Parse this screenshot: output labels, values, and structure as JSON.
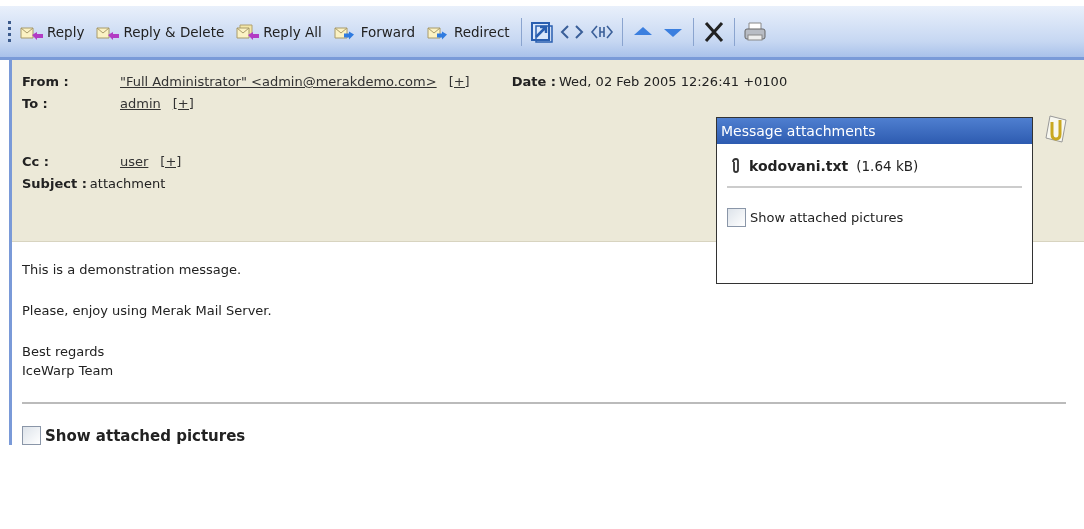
{
  "toolbar": {
    "items": [
      {
        "kind": "reply",
        "label": "Reply"
      },
      {
        "kind": "reply",
        "label": "Reply & Delete"
      },
      {
        "kind": "reply-all",
        "label": "Reply All"
      },
      {
        "kind": "forward",
        "label": "Forward"
      },
      {
        "kind": "forward",
        "label": "Redirect"
      },
      {
        "kind": "separator"
      },
      {
        "kind": "popout"
      },
      {
        "kind": "source"
      },
      {
        "kind": "source-alt"
      },
      {
        "kind": "separator"
      },
      {
        "kind": "up"
      },
      {
        "kind": "down"
      },
      {
        "kind": "separator"
      },
      {
        "kind": "delete"
      },
      {
        "kind": "separator"
      },
      {
        "kind": "print"
      }
    ]
  },
  "header": {
    "from": {
      "label": "From :",
      "value": "\"Full Administrator\" <admin@merakdemo.com>",
      "add": "[+]"
    },
    "date": {
      "label": "Date :",
      "value": "Wed, 02 Feb 2005 12:26:41 +0100"
    },
    "to": {
      "label": "To :",
      "value": "admin",
      "add": "[+]"
    },
    "cc": {
      "label": "Cc :",
      "value": "user",
      "add": "[+]"
    },
    "subject": {
      "label": "Subject :",
      "value": "attachment"
    }
  },
  "attachments_popup": {
    "title": "Message attachments",
    "file": {
      "name": "kodovani.txt",
      "size": "(1.64 kB)"
    },
    "show_pictures": {
      "label": "Show attached pictures",
      "checked": false
    }
  },
  "body": [
    "This is a demonstration message.",
    "Please, enjoy using Merak Mail Server.",
    "Best regards\nIceWarp Team"
  ],
  "show_pictures": {
    "label": "Show attached pictures",
    "checked": false
  }
}
